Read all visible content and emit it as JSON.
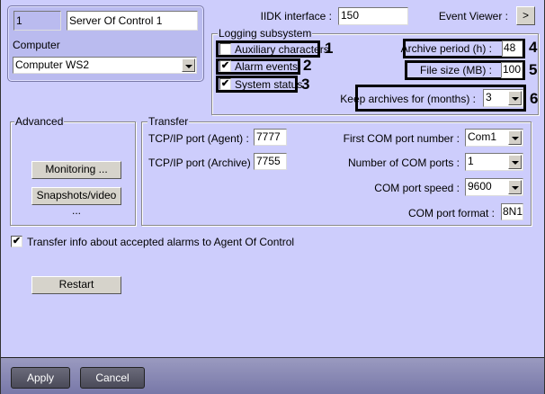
{
  "server": {
    "id": "1",
    "name": "Server Of Control 1",
    "computer_label": "Computer",
    "computer_value": "Computer WS2"
  },
  "iidk": {
    "label": "IIDK interface :",
    "value": "150"
  },
  "event_viewer": {
    "label": "Event Viewer :",
    "button": ">"
  },
  "logging": {
    "title": "Logging subsystem",
    "aux": {
      "label": "Auxiliary characters",
      "checked": false,
      "num": "1"
    },
    "alarm": {
      "label": "Alarm events",
      "checked": true,
      "num": "2"
    },
    "status": {
      "label": "System status",
      "checked": true,
      "num": "3"
    },
    "archive_period": {
      "label": "Archive period (h) :",
      "value": "48",
      "num": "4"
    },
    "file_size": {
      "label": "File size (MB) :",
      "value": "100",
      "num": "5"
    },
    "keep": {
      "label": "Keep archives for (months) :",
      "value": "3",
      "num": "6"
    }
  },
  "advanced": {
    "title": "Advanced",
    "monitoring": "Monitoring ...",
    "snapshots": "Snapshots/video ..."
  },
  "transfer": {
    "title": "Transfer",
    "agent_port": {
      "label": "TCP/IP port (Agent) :",
      "value": "7777"
    },
    "archive_port": {
      "label": "TCP/IP port (Archive) :",
      "value": "7755"
    },
    "first_com": {
      "label": "First COM port number :",
      "value": "Com1"
    },
    "num_com": {
      "label": "Number of COM ports :",
      "value": "1"
    },
    "speed": {
      "label": "COM port speed :",
      "value": "9600"
    },
    "format": {
      "label": "COM port format :",
      "value": "8N1"
    }
  },
  "transfer_info": {
    "label": "Transfer info about accepted alarms to Agent Of Control",
    "checked": true
  },
  "restart": "Restart",
  "footer": {
    "apply": "Apply",
    "cancel": "Cancel"
  },
  "check_glyph": "✔"
}
